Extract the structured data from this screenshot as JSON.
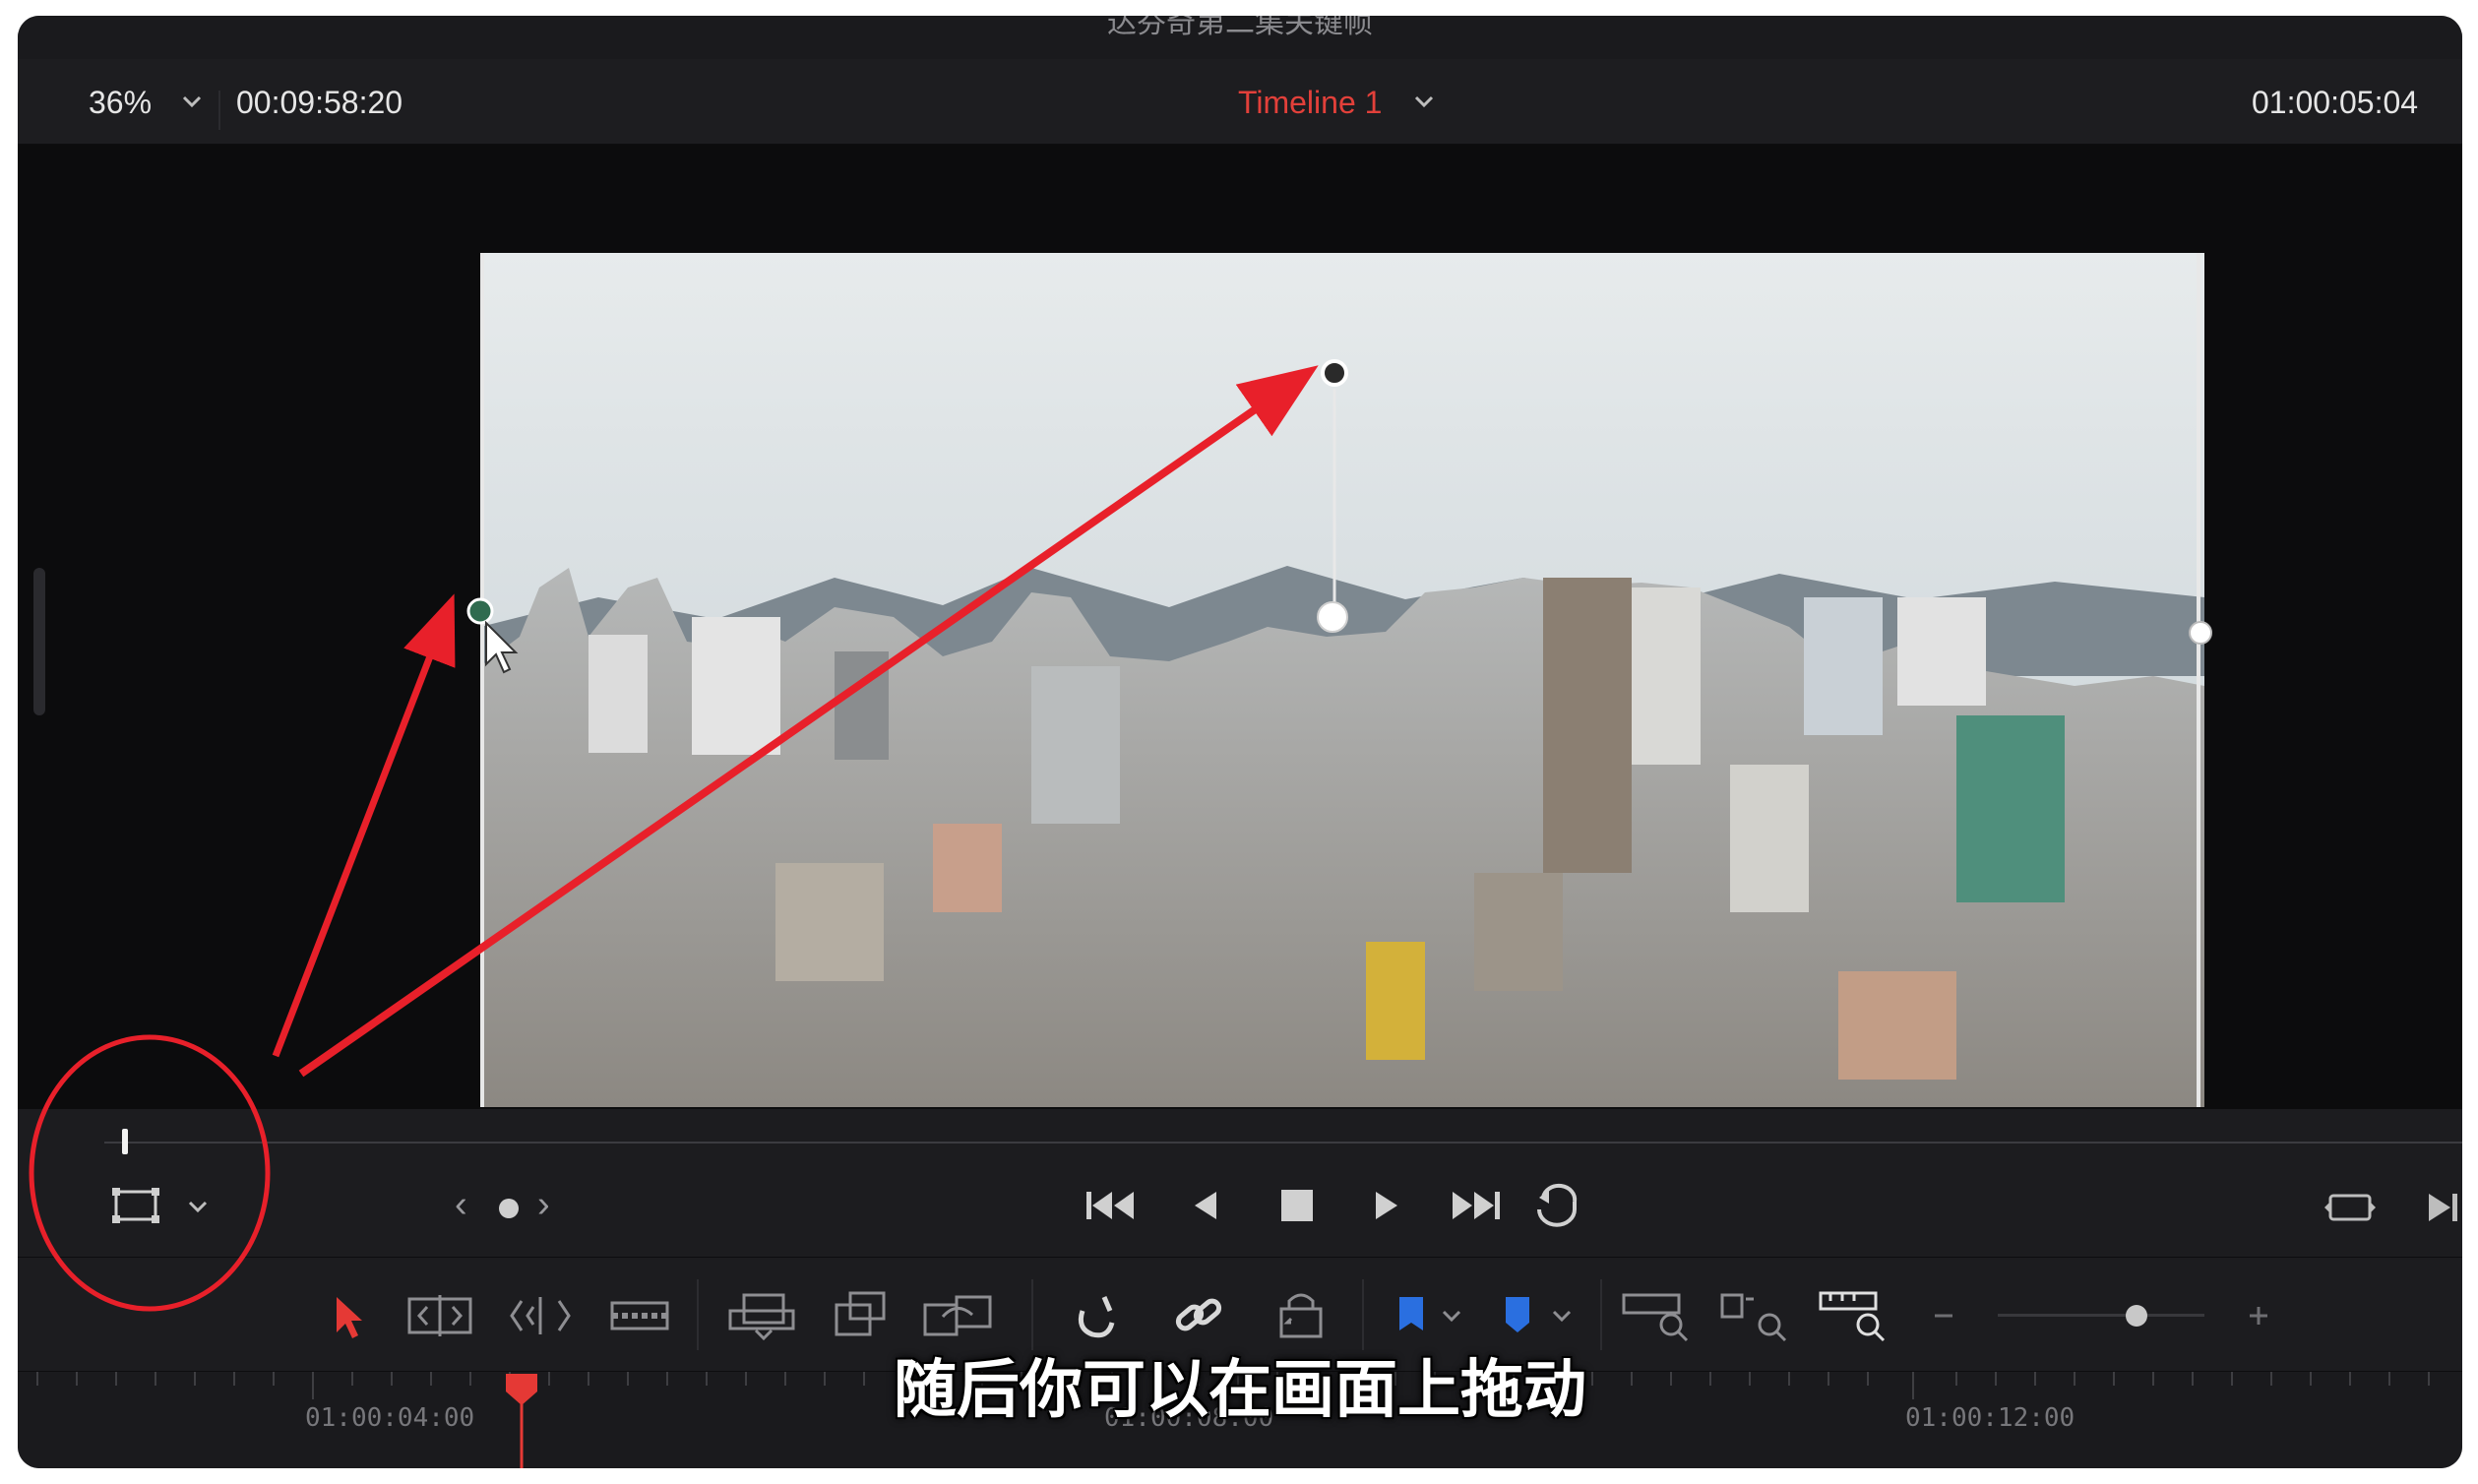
{
  "window": {
    "title": "达芬奇第二集关键帧"
  },
  "viewer_header": {
    "zoom_level": "36%",
    "source_timecode": "00:09:58:20",
    "timeline_name": "Timeline 1",
    "record_timecode": "01:00:05:04"
  },
  "viewer": {
    "transform_mode_icon": "transform-icon",
    "crop_handle_color": "#2f6b4f"
  },
  "transport": {
    "keyframe_nav": {
      "prev": "‹",
      "next": "›"
    },
    "scrubber_position": 0.0
  },
  "toolbar": {
    "zoom_slider_value": 0.66
  },
  "ruler": {
    "labels": [
      "01:00:04:00",
      "01:00:08:00",
      "01:00:12:00"
    ],
    "playhead_color": "#e53935"
  },
  "subtitle": "随后你可以在画面上拖动",
  "annotation": {
    "color": "#e8202a"
  }
}
